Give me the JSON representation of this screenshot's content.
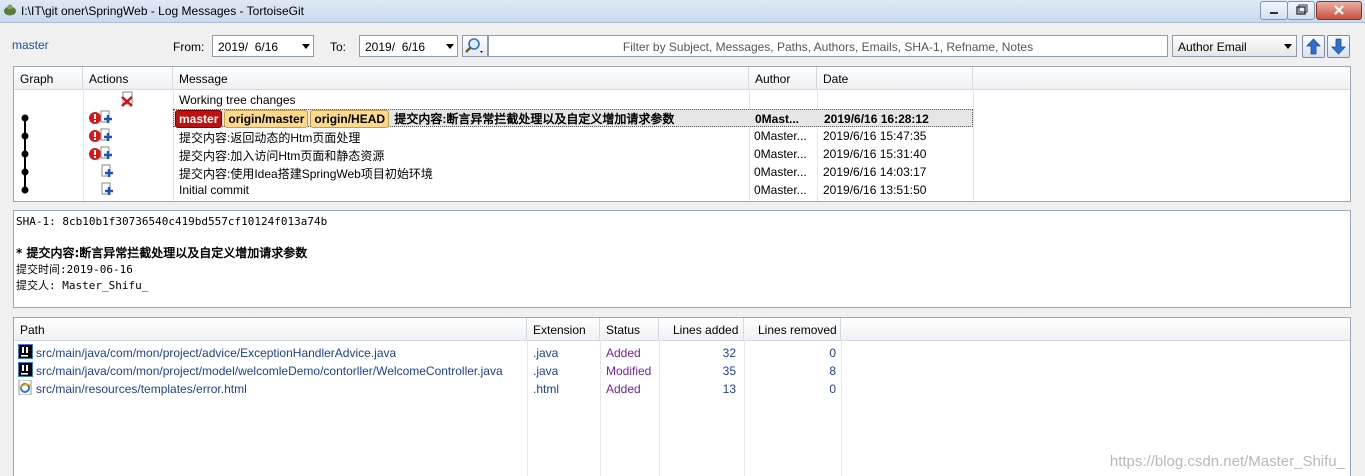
{
  "window": {
    "title": "I:\\IT\\git oner\\SpringWeb - Log Messages - TortoiseGit"
  },
  "toolbar": {
    "branch_link": "master",
    "from_label": "From:",
    "from_date": "2019/  6/16",
    "to_label": "To:",
    "to_date": "2019/  6/16",
    "filter_placeholder": "Filter by Subject, Messages, Paths, Authors, Emails, SHA-1, Refname, Notes",
    "filter_field": "Author Email"
  },
  "log": {
    "columns": [
      "Graph",
      "Actions",
      "Message",
      "Author",
      "Date"
    ],
    "rows": [
      {
        "message": "Working tree changes",
        "author": "",
        "date": ""
      },
      {
        "tags": [
          "master",
          "origin/master",
          "origin/HEAD"
        ],
        "message": "提交内容:断言异常拦截处理以及自定义增加请求参数",
        "author": "0Mast...",
        "date": "2019/6/16 16:28:12"
      },
      {
        "message": "提交内容:返回动态的Htm页面处理",
        "author": "0Master...",
        "date": "2019/6/16 15:47:35"
      },
      {
        "message": "提交内容:加入访问Htm页面和静态资源",
        "author": "0Master...",
        "date": "2019/6/16 15:31:40"
      },
      {
        "message": "提交内容:使用Idea搭建SpringWeb项目初始环境",
        "author": "0Master...",
        "date": "2019/6/16 14:03:17"
      },
      {
        "message": "Initial commit",
        "author": "0Master...",
        "date": "2019/6/16 13:51:50"
      }
    ]
  },
  "details": {
    "sha": "SHA-1: 8cb10b1f30736540c419bd557cf10124f013a74b",
    "subject": "* 提交内容:断言异常拦截处理以及自定义增加请求参数",
    "line1": "提交时间:2019-06-16",
    "line2": "提交人: Master_Shifu_"
  },
  "files": {
    "columns": [
      "Path",
      "Extension",
      "Status",
      "Lines added",
      "Lines removed"
    ],
    "rows": [
      {
        "path": "src/main/java/com/mon/project/advice/ExceptionHandlerAdvice.java",
        "ext": ".java",
        "status": "Added",
        "added": "32",
        "removed": "0",
        "icon": "intellij-icon"
      },
      {
        "path": "src/main/java/com/mon/project/model/welcomleDemo/contorller/WelcomeController.java",
        "ext": ".java",
        "status": "Modified",
        "added": "35",
        "removed": "8",
        "icon": "intellij-icon"
      },
      {
        "path": "src/main/resources/templates/error.html",
        "ext": ".html",
        "status": "Added",
        "added": "13",
        "removed": "0",
        "icon": "ie-html-icon"
      }
    ]
  },
  "watermark": "https://blog.csdn.net/Master_Shifu_"
}
